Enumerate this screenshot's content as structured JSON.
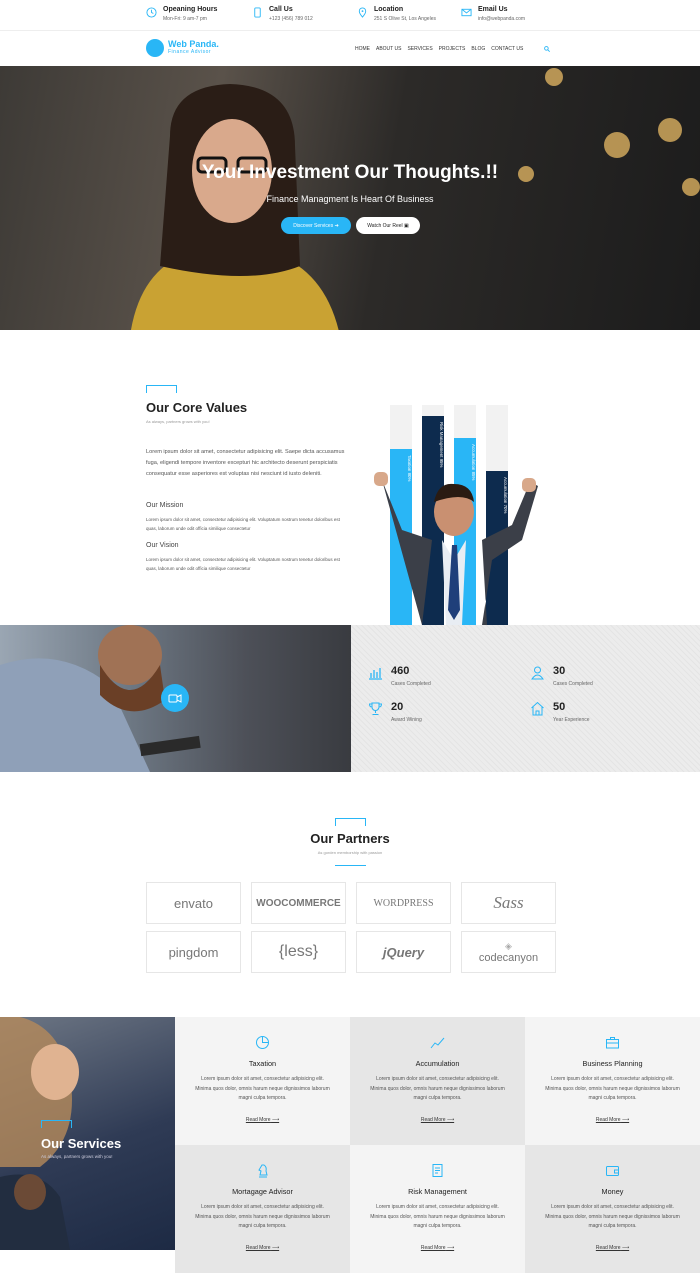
{
  "topbar": {
    "hours": {
      "title": "Opeaning Hours",
      "value": "Mon-Fri: 9 am-7 pm",
      "icon": "clock-icon"
    },
    "call": {
      "title": "Call Us",
      "value": "+123 (456) 789 012",
      "icon": "phone-icon"
    },
    "location": {
      "title": "Location",
      "value": "251 S Olive St, Los Angeles",
      "icon": "pin-icon"
    },
    "email": {
      "title": "Email Us",
      "value": "info@webpanda.com",
      "icon": "mail-icon"
    }
  },
  "brand": {
    "name": "Web Panda.",
    "tagline": "Finance Advisor",
    "accent": "#29b6f6"
  },
  "nav": {
    "items": [
      "HOME",
      "ABOUT US",
      "SERVICES",
      "PROJECTS",
      "BLOG",
      "CONTACT US"
    ]
  },
  "hero": {
    "title": "Your Investment Our Thoughts.!!",
    "subtitle": "Finance Managment Is Heart Of Business",
    "primary_button": "Discover Services",
    "secondary_button": "Watch Our Reel"
  },
  "core": {
    "title": "Our Core Values",
    "subtitle": "As always, partners grows with you!",
    "paragraph": "Lorem ipsum dolor sit amet, consectetur adipisicing elit. Saepe dicta accusamus fuga, eligendi tempore inventore excepturi hic architecto deserunt perspiciatis consequatur esse asperiores est voluptas nisi nesciunt id iusto deleniti.",
    "mission_title": "Our Mission",
    "mission_text": "Lorem ipsum dolor sit amet, consectetur adipisicing elit. Voluptatum nostrum tenetur doloribus est quas, laborum unde odit officia similique consectetur",
    "vision_title": "Our Vision",
    "vision_text": "Lorem ipsum dolor sit amet, consectetur adipisicing elit. Voluptatum nostrum tenetur doloribus est quas, laborum unde odit officia similique consectetur",
    "bars": [
      {
        "label": "Taxation 80%",
        "value": 80,
        "color": "#29b6f6"
      },
      {
        "label": "Risk Management 95%",
        "value": 95,
        "color": "#0d2b4e"
      },
      {
        "label": "Accumulation 85%",
        "value": 85,
        "color": "#29b6f6"
      },
      {
        "label": "Accumulation 70%",
        "value": 70,
        "color": "#0d2b4e"
      }
    ]
  },
  "stats": [
    {
      "number": "460",
      "label": "Cases Completed",
      "icon": "chart-icon"
    },
    {
      "number": "30",
      "label": "Cases Completed",
      "icon": "user-icon"
    },
    {
      "number": "20",
      "label": "Award Wining",
      "icon": "trophy-icon"
    },
    {
      "number": "50",
      "label": "Year Experience",
      "icon": "home-icon"
    }
  ],
  "partners": {
    "title": "Our Partners",
    "subtitle": "As gorden memborship with passion",
    "logos": [
      "envato",
      "WOOCOMMERCE",
      "WORDPRESS",
      "Sass",
      "pingdom",
      "{less}",
      "jQuery",
      "codecanyon"
    ]
  },
  "services": {
    "title": "Our Services",
    "subtitle": "As always, partners grows with you!",
    "items": [
      {
        "title": "Taxation",
        "desc": "Lorem ipsum dolor sit amet, consectetur adipisicing elit. Minima quos dolor, omnis harum neque dignissimos laborum magni culpa tempora.",
        "more": "Read More",
        "icon": "pie-chart-icon"
      },
      {
        "title": "Accumulation",
        "desc": "Lorem ipsum dolor sit amet, consectetur adipisicing elit. Minima quos dolor, omnis harum neque dignissimos laborum magni culpa tempora.",
        "more": "Read More",
        "icon": "trend-line-icon"
      },
      {
        "title": "Business Planning",
        "desc": "Lorem ipsum dolor sit amet, consectetur adipisicing elit. Minima quos dolor, omnis harum neque dignissimos laborum magni culpa tempora.",
        "more": "Read More",
        "icon": "briefcase-icon"
      },
      {
        "title": "Mortagage Advisor",
        "desc": "Lorem ipsum dolor sit amet, consectetur adipisicing elit. Minima quos dolor, omnis harum neque dignissimos laborum magni culpa tempora.",
        "more": "Read More",
        "icon": "chess-knight-icon"
      },
      {
        "title": "Risk Management",
        "desc": "Lorem ipsum dolor sit amet, consectetur adipisicing elit. Minima quos dolor, omnis harum neque dignissimos laborum magni culpa tempora.",
        "more": "Read More",
        "icon": "document-icon"
      },
      {
        "title": "Money",
        "desc": "Lorem ipsum dolor sit amet, consectetur adipisicing elit. Minima quos dolor, omnis harum neque dignissimos laborum magni culpa tempora.",
        "more": "Read More",
        "icon": "wallet-icon"
      }
    ]
  }
}
